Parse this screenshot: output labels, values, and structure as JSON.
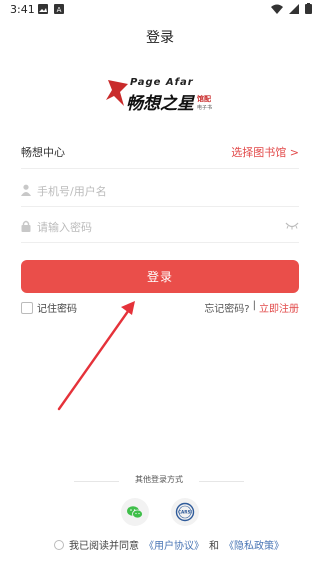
{
  "status_bar": {
    "time": "3:41"
  },
  "header": {
    "title": "登录"
  },
  "logo": {
    "top_text": "Page Afar",
    "main_text": "畅想之星",
    "side_text": "馆配",
    "side_subtext": "电子书"
  },
  "library": {
    "label": "畅想中心",
    "select_link": "选择图书馆 >"
  },
  "form": {
    "username_placeholder": "手机号/用户名",
    "password_placeholder": "请输入密码",
    "login_label": "登录",
    "remember_label": "记住密码",
    "forgot_label": "忘记密码?",
    "separator": "|",
    "register_label": "立即注册"
  },
  "other_login": {
    "label": "其他登录方式",
    "cars_badge": "CARSI"
  },
  "agreement": {
    "prefix": "我已阅读并同意",
    "user_agreement": "《用户协议》",
    "and": "和",
    "privacy_policy": "《隐私政策》"
  },
  "colors": {
    "accent": "#ea4e4a",
    "link_blue": "#4a76b5",
    "wechat_green": "#3fbf4a"
  }
}
